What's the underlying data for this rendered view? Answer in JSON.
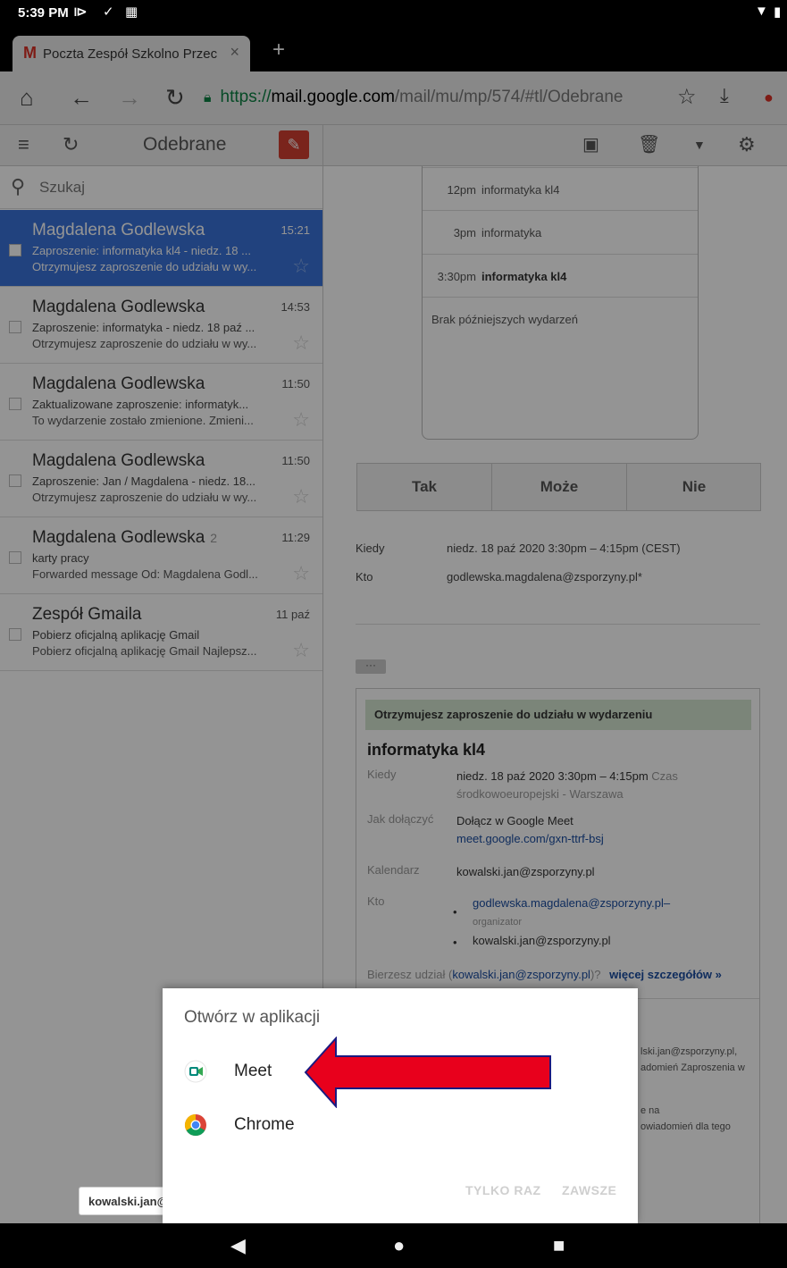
{
  "status": {
    "time": "5:39 PM",
    "icons": [
      "play-icon",
      "check-icon",
      "image-icon",
      "wifi-icon",
      "battery-icon"
    ]
  },
  "browser": {
    "tab_title": "Poczta Zespół Szkolno Przec",
    "url_scheme": "https://",
    "url_host": "mail.google.com",
    "url_path": "/mail/mu/mp/574/#tl/Odebrane"
  },
  "gmail": {
    "folder": "Odebrane",
    "search_placeholder": "Szukaj",
    "accent": "#d23f31",
    "selected_color": "#3a73d9",
    "emails": [
      {
        "sender": "Magdalena Godlewska",
        "count": "",
        "time": "15:21",
        "subject": "Zaproszenie: informatyka kl4 - niedz. 18 ...",
        "snippet": "Otrzymujesz zaproszenie do udziału w wy...",
        "selected": true
      },
      {
        "sender": "Magdalena Godlewska",
        "count": "",
        "time": "14:53",
        "subject": "Zaproszenie: informatyka - niedz. 18 paź ...",
        "snippet": "Otrzymujesz zaproszenie do udziału w wy...",
        "selected": false
      },
      {
        "sender": "Magdalena Godlewska",
        "count": "",
        "time": "11:50",
        "subject": "Zaktualizowane zaproszenie: informatyk...",
        "snippet": "To wydarzenie zostało zmienione. Zmieni...",
        "selected": false
      },
      {
        "sender": "Magdalena Godlewska",
        "count": "",
        "time": "11:50",
        "subject": "Zaproszenie: Jan / Magdalena - niedz. 18...",
        "snippet": "Otrzymujesz zaproszenie do udziału w wy...",
        "selected": false
      },
      {
        "sender": "Magdalena Godlewska",
        "count": "2",
        "time": "11:29",
        "subject": "karty pracy",
        "snippet": "Forwarded message Od: Magdalena Godl...",
        "selected": false
      },
      {
        "sender": "Zespół Gmaila",
        "count": "",
        "time": "11 paź",
        "subject": "Pobierz oficjalną aplikację Gmail",
        "snippet": "Pobierz oficjalną aplikację Gmail Najlepsz...",
        "selected": false
      }
    ]
  },
  "agenda": [
    {
      "time": "12pm",
      "event": "informatyka kl4"
    },
    {
      "time": "3pm",
      "event": "informatyka"
    },
    {
      "time": "3:30pm",
      "event": "informatyka kl4"
    }
  ],
  "agenda_empty": "Brak późniejszych wydarzeń",
  "rsvp": {
    "yes": "Tak",
    "maybe": "Może",
    "no": "Nie"
  },
  "meta": {
    "when_label": "Kiedy",
    "when_value": "niedz. 18 paź 2020 3:30pm – 4:15pm (CEST)",
    "who_label": "Kto",
    "who_value": "godlewska.magdalena@zsporzyny.pl*"
  },
  "invite": {
    "banner": "Otrzymujesz zaproszenie do udziału w wydarzeniu",
    "title": "informatyka kl4",
    "when_label": "Kiedy",
    "when_value": "niedz. 18 paź 2020 3:30pm – 4:15pm",
    "when_tz": "Czas środkowoeuropejski - Warszawa",
    "join_label": "Jak dołączyć",
    "join_value": "Dołącz w Google Meet",
    "join_link": "meet.google.com/gxn-ttrf-bsj",
    "calendar_label": "Kalendarz",
    "calendar_value": "kowalski.jan@zsporzyny.pl",
    "who_label": "Kto",
    "who_1": "godlewska.magdalena@zsporzyny.pl",
    "who_1_role": "organizator",
    "who_2": "kowalski.jan@zsporzyny.pl",
    "attending_prefix": "Bierzesz udział (",
    "attending_email": "kowalski.jan@zsporzyny.pl",
    "attending_suffix": ")?",
    "more_details": "więcej szczegółów »",
    "faded_1": "lski.jan@zsporzyny.pl,",
    "faded_2": "adomień Zaproszenia w",
    "faded_3": "e na",
    "faded_4": "owiadomień dla tego"
  },
  "footer_chip": "kowalski.jan@",
  "dialog": {
    "title": "Otwórz w aplikacji",
    "options": [
      {
        "label": "Meet",
        "icon": "meet-icon"
      },
      {
        "label": "Chrome",
        "icon": "chrome-icon"
      }
    ],
    "just_once": "TYLKO RAZ",
    "always": "ZAWSZE"
  },
  "annotation_arrow_color": "#e8001c"
}
